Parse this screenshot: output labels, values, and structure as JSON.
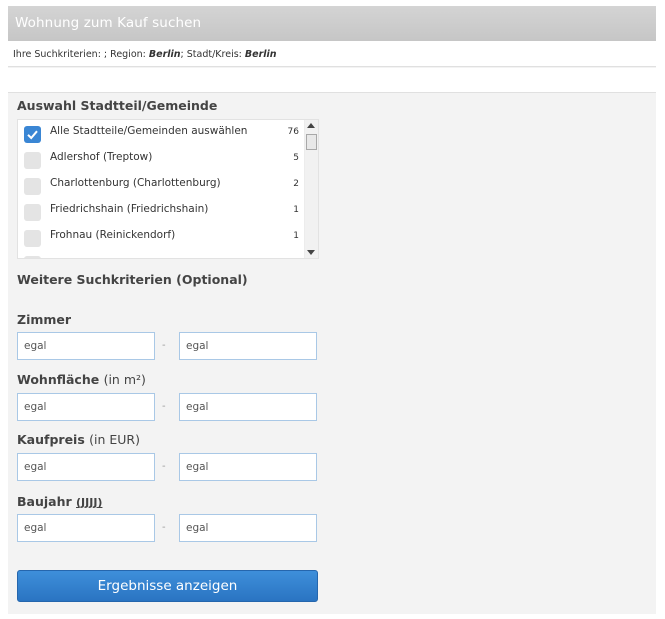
{
  "header": {
    "title": "Wohnung zum Kauf suchen"
  },
  "criteria": {
    "prefix": "Ihre Suchkriterien: ; Region: ",
    "region": "Berlin",
    "middle": "; Stadt/Kreis: ",
    "city": "Berlin"
  },
  "districts": {
    "title": "Auswahl Stadtteil/Gemeinde",
    "items": [
      {
        "label": "Alle Stadtteile/Gemeinden auswählen",
        "count": "76",
        "checked": true
      },
      {
        "label": "Adlershof (Treptow)",
        "count": "5",
        "checked": false
      },
      {
        "label": "Charlottenburg (Charlottenburg)",
        "count": "2",
        "checked": false
      },
      {
        "label": "Friedrichshain (Friedrichshain)",
        "count": "1",
        "checked": false
      },
      {
        "label": "Frohnau (Reinickendorf)",
        "count": "1",
        "checked": false
      }
    ]
  },
  "optional": {
    "title": "Weitere Suchkriterien (Optional)"
  },
  "fields": {
    "dash": "-",
    "rooms": {
      "label": "Zimmer",
      "from_placeholder": "egal",
      "to_placeholder": "egal"
    },
    "area": {
      "label": "Wohnfläche",
      "unit": "(in m²)",
      "from_placeholder": "egal",
      "to_placeholder": "egal"
    },
    "price": {
      "label": "Kaufpreis",
      "unit": "(in EUR)",
      "from_placeholder": "egal",
      "to_placeholder": "egal"
    },
    "year": {
      "label": "Baujahr",
      "unit": "(JJJJ)",
      "from_placeholder": "egal",
      "to_placeholder": "egal"
    }
  },
  "submit": {
    "label": "Ergebnisse anzeigen"
  },
  "colors": {
    "accent": "#3a86d4",
    "header": "#c9c9c9",
    "input_border": "#a9c8e6"
  }
}
